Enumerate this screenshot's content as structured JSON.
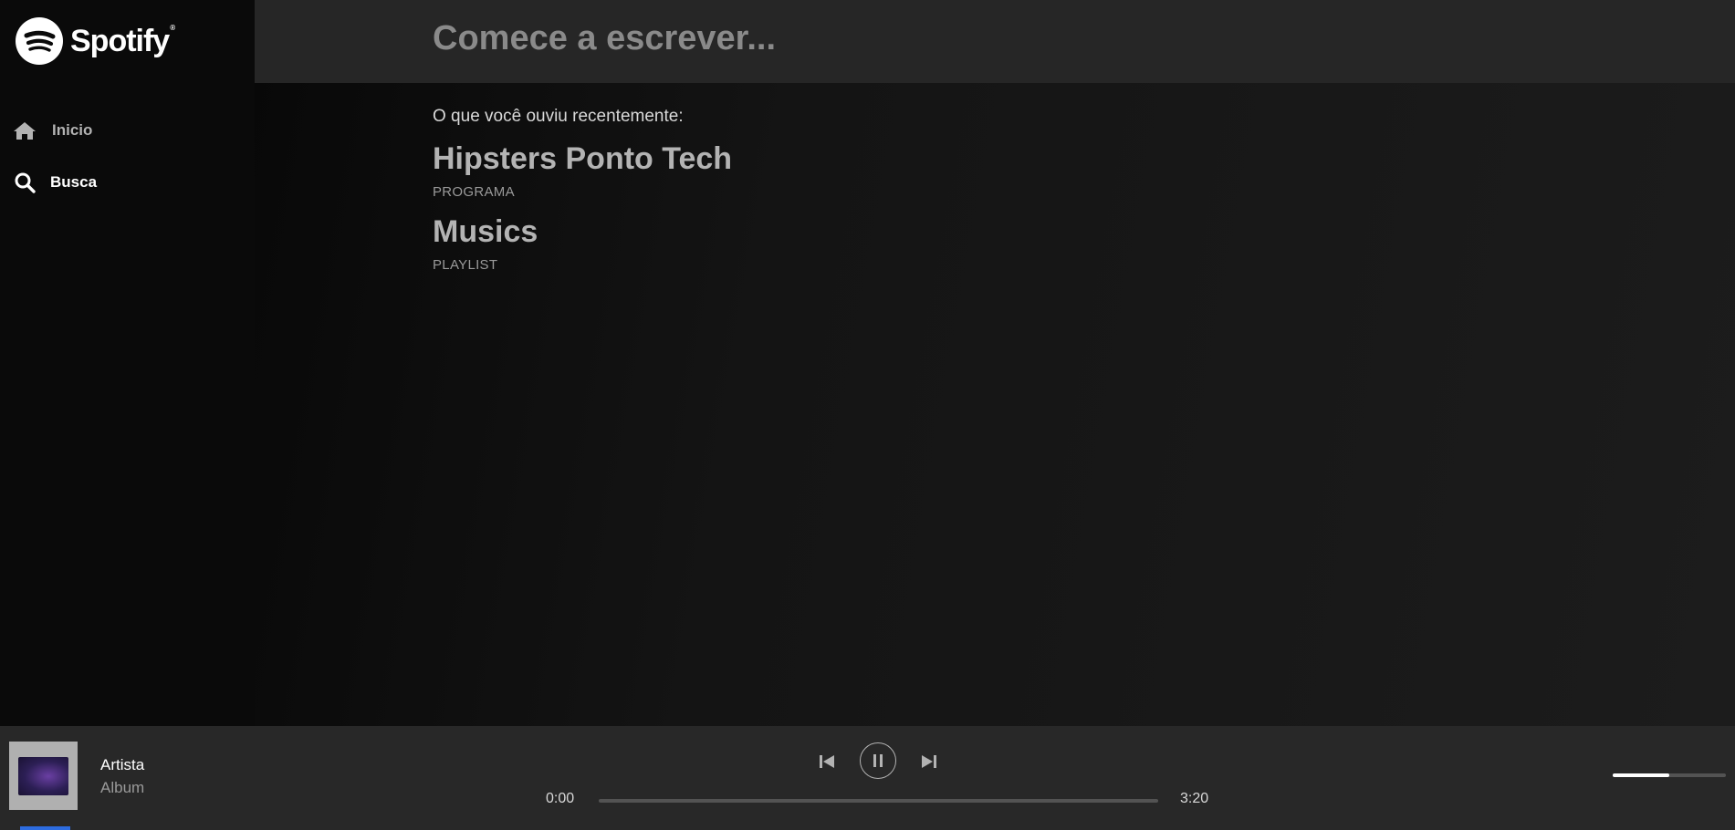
{
  "brand": {
    "name": "Spotify",
    "reg": "®",
    "logo_icon": "spotify-logo-icon"
  },
  "sidebar": {
    "items": [
      {
        "label": "Inicio",
        "icon": "home-icon"
      },
      {
        "label": "Busca",
        "icon": "search-icon"
      }
    ]
  },
  "search": {
    "placeholder": "Comece a escrever..."
  },
  "recent": {
    "heading": "O que você ouviu recentemente:",
    "items": [
      {
        "title": "Hipsters Ponto Tech",
        "type": "PROGRAMA"
      },
      {
        "title": "Musics",
        "type": "PLAYLIST"
      }
    ]
  },
  "player": {
    "artist": "Artista",
    "album": "Album",
    "time_current": "0:00",
    "time_total": "3:20",
    "progress_fraction": 0.0,
    "volume_fraction": 0.5,
    "controls": {
      "prev_icon": "skip-previous-icon",
      "pause_icon": "pause-icon",
      "next_icon": "skip-next-icon"
    }
  },
  "colors": {
    "background": "#121212",
    "sidebar": "#0a0a0a",
    "search_bar": "#262626",
    "player_bar": "#282828",
    "text_muted": "#b3b3b3"
  }
}
